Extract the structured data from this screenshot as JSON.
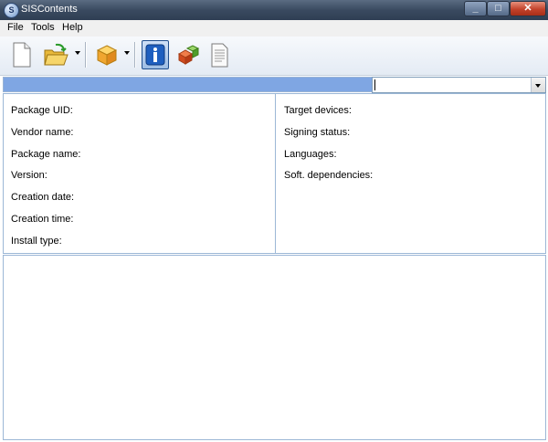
{
  "window": {
    "title": "SISContents",
    "minimize_glyph": "_",
    "maximize_glyph": "□",
    "close_glyph": "✕"
  },
  "menu": {
    "items": [
      "File",
      "Tools",
      "Help"
    ]
  },
  "toolbar": {
    "buttons": [
      {
        "icon": "new-document-icon"
      },
      {
        "icon": "open-folder-icon"
      },
      {
        "icon": "package-icon"
      },
      {
        "icon": "info-icon",
        "active": true
      },
      {
        "icon": "components-icon"
      },
      {
        "icon": "text-document-icon"
      }
    ]
  },
  "selection": {
    "value": ""
  },
  "info": {
    "left": [
      "Package UID:",
      "Vendor name:",
      "Package name:",
      "Version:",
      "Creation date:",
      "Creation time:",
      "Install type:"
    ],
    "right": [
      "Target devices:",
      "Signing status:",
      "Languages:",
      "Soft. dependencies:"
    ]
  },
  "colors": {
    "titlebar": "#3a4a60",
    "selection_bar": "#7fa6e3",
    "panel_border": "#9cb7d6"
  }
}
